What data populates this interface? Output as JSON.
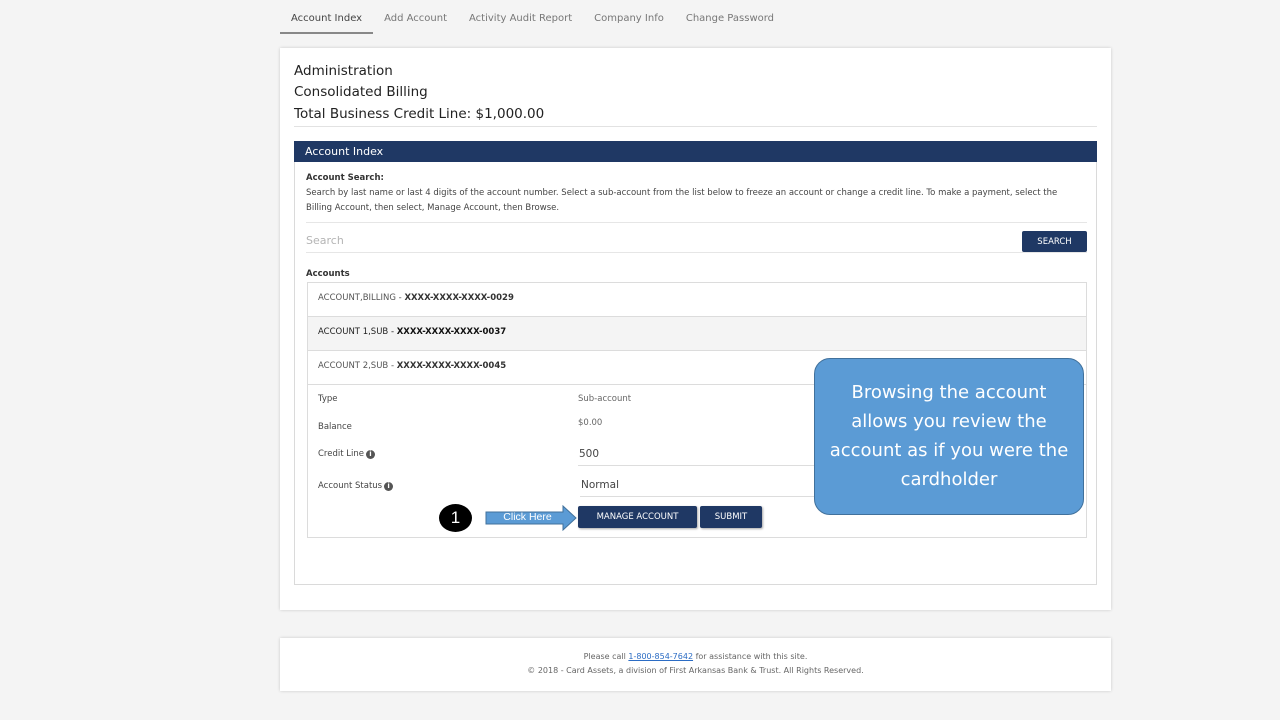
{
  "tabs": [
    {
      "label": "Account Index",
      "active": true
    },
    {
      "label": "Add Account",
      "active": false
    },
    {
      "label": "Activity Audit Report",
      "active": false
    },
    {
      "label": "Company Info",
      "active": false
    },
    {
      "label": "Change Password",
      "active": false
    }
  ],
  "header": {
    "line1": "Administration",
    "line2": "Consolidated Billing",
    "line3": "Total Business Credit Line: $1,000.00"
  },
  "panel": {
    "title": "Account Index",
    "search_title": "Account Search:",
    "search_description": "Search by last name or last 4 digits of the account number. Select a sub-account from the list below to freeze an account or change a credit line. To make a payment, select the Billing Account, then select, Manage Account, then Browse.",
    "search_placeholder": "Search",
    "search_button": "SEARCH",
    "accounts_label": "Accounts"
  },
  "accounts": [
    {
      "name": "ACCOUNT,BILLING - ",
      "number": "XXXX-XXXX-XXXX-0029"
    },
    {
      "name": "ACCOUNT 1,SUB - ",
      "number": "XXXX-XXXX-XXXX-0037"
    },
    {
      "name": "ACCOUNT 2,SUB - ",
      "number": "XXXX-XXXX-XXXX-0045"
    }
  ],
  "detail": {
    "type_label": "Type",
    "type_value": "Sub-account",
    "balance_label": "Balance",
    "balance_value": "$0.00",
    "credit_line_label": "Credit Line",
    "credit_line_value": "500",
    "status_label": "Account Status",
    "status_value": "Normal",
    "manage_button": "MANAGE ACCOUNT",
    "submit_button": "SUBMIT"
  },
  "annotation": {
    "step_number": "1",
    "arrow_text": "Click Here",
    "callout_text": "Browsing the account allows you review the account as if you were the cardholder"
  },
  "footer": {
    "call_prefix": "Please call ",
    "phone": "1-800-854-7642",
    "call_suffix": " for assistance with this site.",
    "copyright": "© 2018 - Card Assets, a division of First Arkansas Bank & Trust. All Rights Reserved."
  },
  "colors": {
    "navy": "#1f3864",
    "callout_blue": "#5b9bd5",
    "link_blue": "#2b6cc4"
  },
  "icons": [
    "info-icon",
    "arrow-right-icon"
  ]
}
